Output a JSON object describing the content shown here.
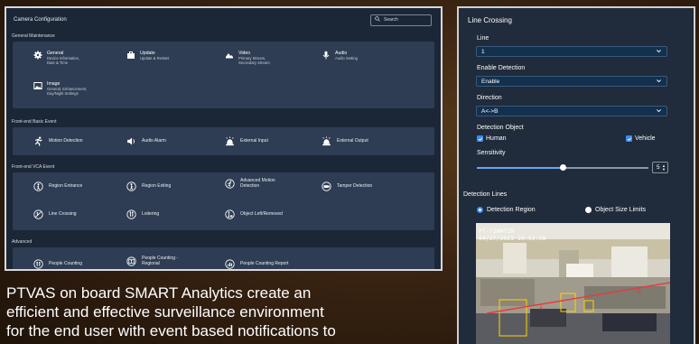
{
  "left": {
    "window_title": "Camera Configuration",
    "search_placeholder": "Search",
    "sections": {
      "general_maintenance": {
        "title": "General Maintenance",
        "tiles": [
          {
            "title": "General",
            "sub1": "Device Information,",
            "sub2": "Date & Time",
            "icon": "gear-icon"
          },
          {
            "title": "Update",
            "sub1": "Update & Restart",
            "sub2": "",
            "icon": "briefcase-icon"
          },
          {
            "title": "Video",
            "sub1": "Primary Stream,",
            "sub2": "Secondary Stream",
            "icon": "video-icon"
          },
          {
            "title": "Audio",
            "sub1": "Audio Setting",
            "sub2": "",
            "icon": "microphone-icon"
          },
          {
            "title": "Image",
            "sub1": "General, Enhancement,",
            "sub2": "Day/Night Settings",
            "icon": "image-icon"
          }
        ]
      },
      "front_end_basic": {
        "title": "Front-end Basic Event",
        "items": [
          "Motion Detection",
          "Audio Alarm",
          "External Input",
          "External Output"
        ]
      },
      "front_end_vca": {
        "title": "Front-end VCA Event",
        "items": [
          "Region Entrance",
          "Region Exiting",
          "Advanced Motion",
          "Tamper Detection",
          "Line Crossing",
          "Loitering",
          "Object Left/Removed"
        ],
        "advanced_motion_line2": "Detection"
      },
      "advanced": {
        "title": "Advanced",
        "items": [
          "People Counting",
          "People Counting -",
          "People Counting Report"
        ],
        "people_counting_line2": "Regional"
      }
    }
  },
  "caption": {
    "line1": "PTVAS on board SMART Analytics create an",
    "line2": "efficient and effective surveillance environment",
    "line3": "for the end user with event based notifications to"
  },
  "right": {
    "title": "Line Crossing",
    "line_label": "Line",
    "line_value": "1",
    "enable_label": "Enable Detection",
    "enable_value": "Enable",
    "direction_label": "Direction",
    "direction_value": "A<->B",
    "object_label": "Detection Object",
    "human_label": "Human",
    "vehicle_label": "Vehicle",
    "sensitivity_label": "Sensitivity",
    "sensitivity_value": "5",
    "sensitivity_level": 0.5,
    "lines_label": "Detection Lines",
    "region_label": "Detection Region",
    "size_label": "Object Size Limits",
    "cam_line1": "PT-F2WHTIM",
    "cam_line2": "04/27/2023 10:53:58",
    "accent": "#3b8cf3"
  }
}
